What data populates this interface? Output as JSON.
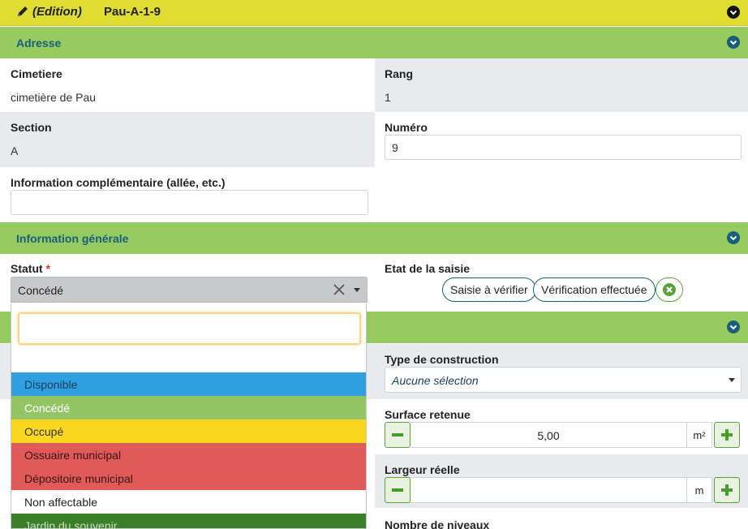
{
  "header": {
    "edition_label": "(Edition)",
    "record_name": "Pau-A-1-9",
    "colors": {
      "bar": "#dfdc33"
    }
  },
  "sections": {
    "adresse": "Adresse",
    "general": "Information générale"
  },
  "adresse": {
    "cimetiere_label": "Cimetiere",
    "cimetiere_value": "cimetière de Pau",
    "rang_label": "Rang",
    "rang_value": "1",
    "section_label": "Section",
    "section_value": "A",
    "numero_label": "Numéro",
    "numero_value": "9",
    "info_label": "Information complémentaire (allée, etc.)",
    "info_value": ""
  },
  "general": {
    "statut_label": "Statut",
    "statut_required": "*",
    "statut_value": "Concédé",
    "etat_label": "Etat de la saisie",
    "etat_buttons": [
      "Saisie à vérifier",
      "Vérification effectuée"
    ],
    "construction_label": "Type de construction",
    "construction_value": "Aucune sélection",
    "surface_label": "Surface retenue",
    "surface_value": "5,00",
    "surface_unit": "m²",
    "largeur_label": "Largeur réelle",
    "largeur_value": "",
    "largeur_unit": "m",
    "niveaux_label": "Nombre de niveaux"
  },
  "dropdown": {
    "search_value": "",
    "options": [
      {
        "label": "Disponible",
        "bg": "#2f9fe0",
        "fg": "#1b3f5c"
      },
      {
        "label": "Concédé",
        "bg": "#94c565",
        "fg": "#ffffff"
      },
      {
        "label": "Occupé",
        "bg": "#fcd720",
        "fg": "#333333"
      },
      {
        "label": "Ossuaire municipal",
        "bg": "#e05a5a",
        "fg": "#3a1414"
      },
      {
        "label": "Dépositoire municipal",
        "bg": "#e05a5a",
        "fg": "#3a1414"
      },
      {
        "label": "Non affectable",
        "bg": "#ffffff",
        "fg": "#222222"
      },
      {
        "label": "Jardin du souvenir",
        "bg": "#3b7f2b",
        "fg": "#c9e0c0"
      }
    ]
  },
  "icons": {
    "pencil": "pencil-icon",
    "chevron": "chevron-down-circle-icon",
    "clear": "close-icon",
    "minus": "minus-icon",
    "plus": "plus-icon"
  }
}
